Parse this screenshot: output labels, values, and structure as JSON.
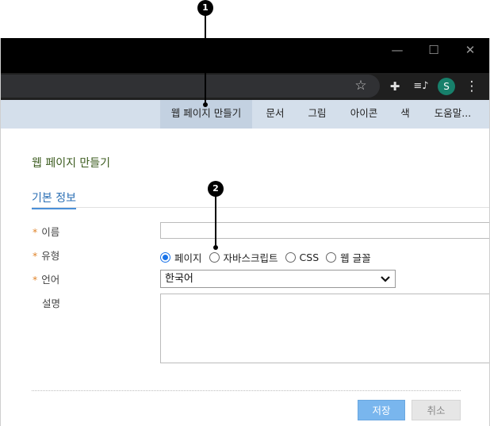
{
  "window": {
    "controls": {
      "minimize": "—",
      "maximize": "☐",
      "close": "✕"
    }
  },
  "toolbar": {
    "icons": [
      "star-icon",
      "extensions-icon",
      "reading-list-icon",
      "profile-avatar",
      "more-icon"
    ],
    "star": "☆",
    "extensions": "✚",
    "reading_list": "≡♪",
    "avatar_letter": "S",
    "more": "⋮"
  },
  "menu": {
    "items": [
      {
        "label": "웹 페이지 만들기",
        "active": true
      },
      {
        "label": "문서"
      },
      {
        "label": "그림"
      },
      {
        "label": "아이콘"
      },
      {
        "label": "색"
      },
      {
        "label": "도움말..."
      }
    ]
  },
  "form": {
    "page_title": "웹 페이지 만들기",
    "section_title": "기본 정보",
    "required_mark": "*",
    "fields": {
      "name": {
        "label": "이름",
        "value": ""
      },
      "type": {
        "label": "유형",
        "options": [
          {
            "label": "페이지",
            "selected": true
          },
          {
            "label": "자바스크립트",
            "selected": false
          },
          {
            "label": "CSS",
            "selected": false
          },
          {
            "label": "웹 글꼴",
            "selected": false
          }
        ]
      },
      "language": {
        "label": "언어",
        "value": "한국어"
      },
      "description": {
        "label": "설명",
        "value": ""
      }
    },
    "buttons": {
      "save": "저장",
      "cancel": "취소"
    }
  },
  "callouts": [
    "1",
    "2"
  ],
  "colors": {
    "menubar": "#d4dfeb",
    "accent": "#1a73e8",
    "save_button": "#79b6ee",
    "avatar": "#17806b",
    "required": "#e0852c"
  }
}
